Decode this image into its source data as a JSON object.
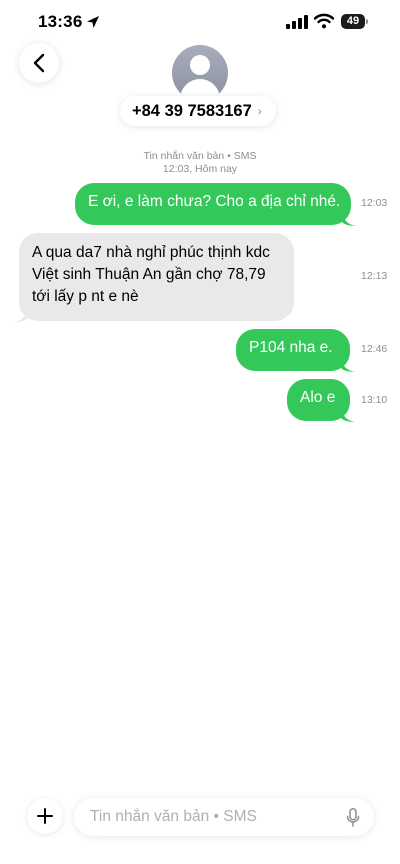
{
  "status_bar": {
    "time": "13:36",
    "battery": "49",
    "icons": [
      "location-arrow-icon",
      "cellular-signal-icon",
      "wifi-icon",
      "battery-icon"
    ]
  },
  "header": {
    "back_icon": "chevron-left-icon",
    "avatar_icon": "person-silhouette-icon",
    "contact": "+84 39 7583167",
    "contact_chevron": "›"
  },
  "conversation": {
    "meta_type": "Tin nhắn văn bản • SMS",
    "meta_time": "12:03, Hôm nay",
    "messages": [
      {
        "direction": "outgoing",
        "text": "E ơi, e làm chưa? Cho a địa chỉ nhé.",
        "time": "12:03"
      },
      {
        "direction": "incoming",
        "text": "A qua da7 nhà nghỉ phúc thịnh kdc Việt sinh Thuận An gần chợ 78,79 tới lấy p nt e nè",
        "time": "12:13"
      },
      {
        "direction": "outgoing",
        "text": "P104 nha e.",
        "time": "12:46"
      },
      {
        "direction": "outgoing",
        "text": "Alo e",
        "time": "13:10"
      }
    ]
  },
  "composer": {
    "plus_icon": "plus-icon",
    "placeholder": "Tin nhắn văn bản • SMS",
    "value": "",
    "mic_icon": "microphone-icon"
  },
  "colors": {
    "outgoing_bubble": "#34c85a",
    "incoming_bubble": "#e9e9eb",
    "secondary_text": "#8e8e93"
  }
}
